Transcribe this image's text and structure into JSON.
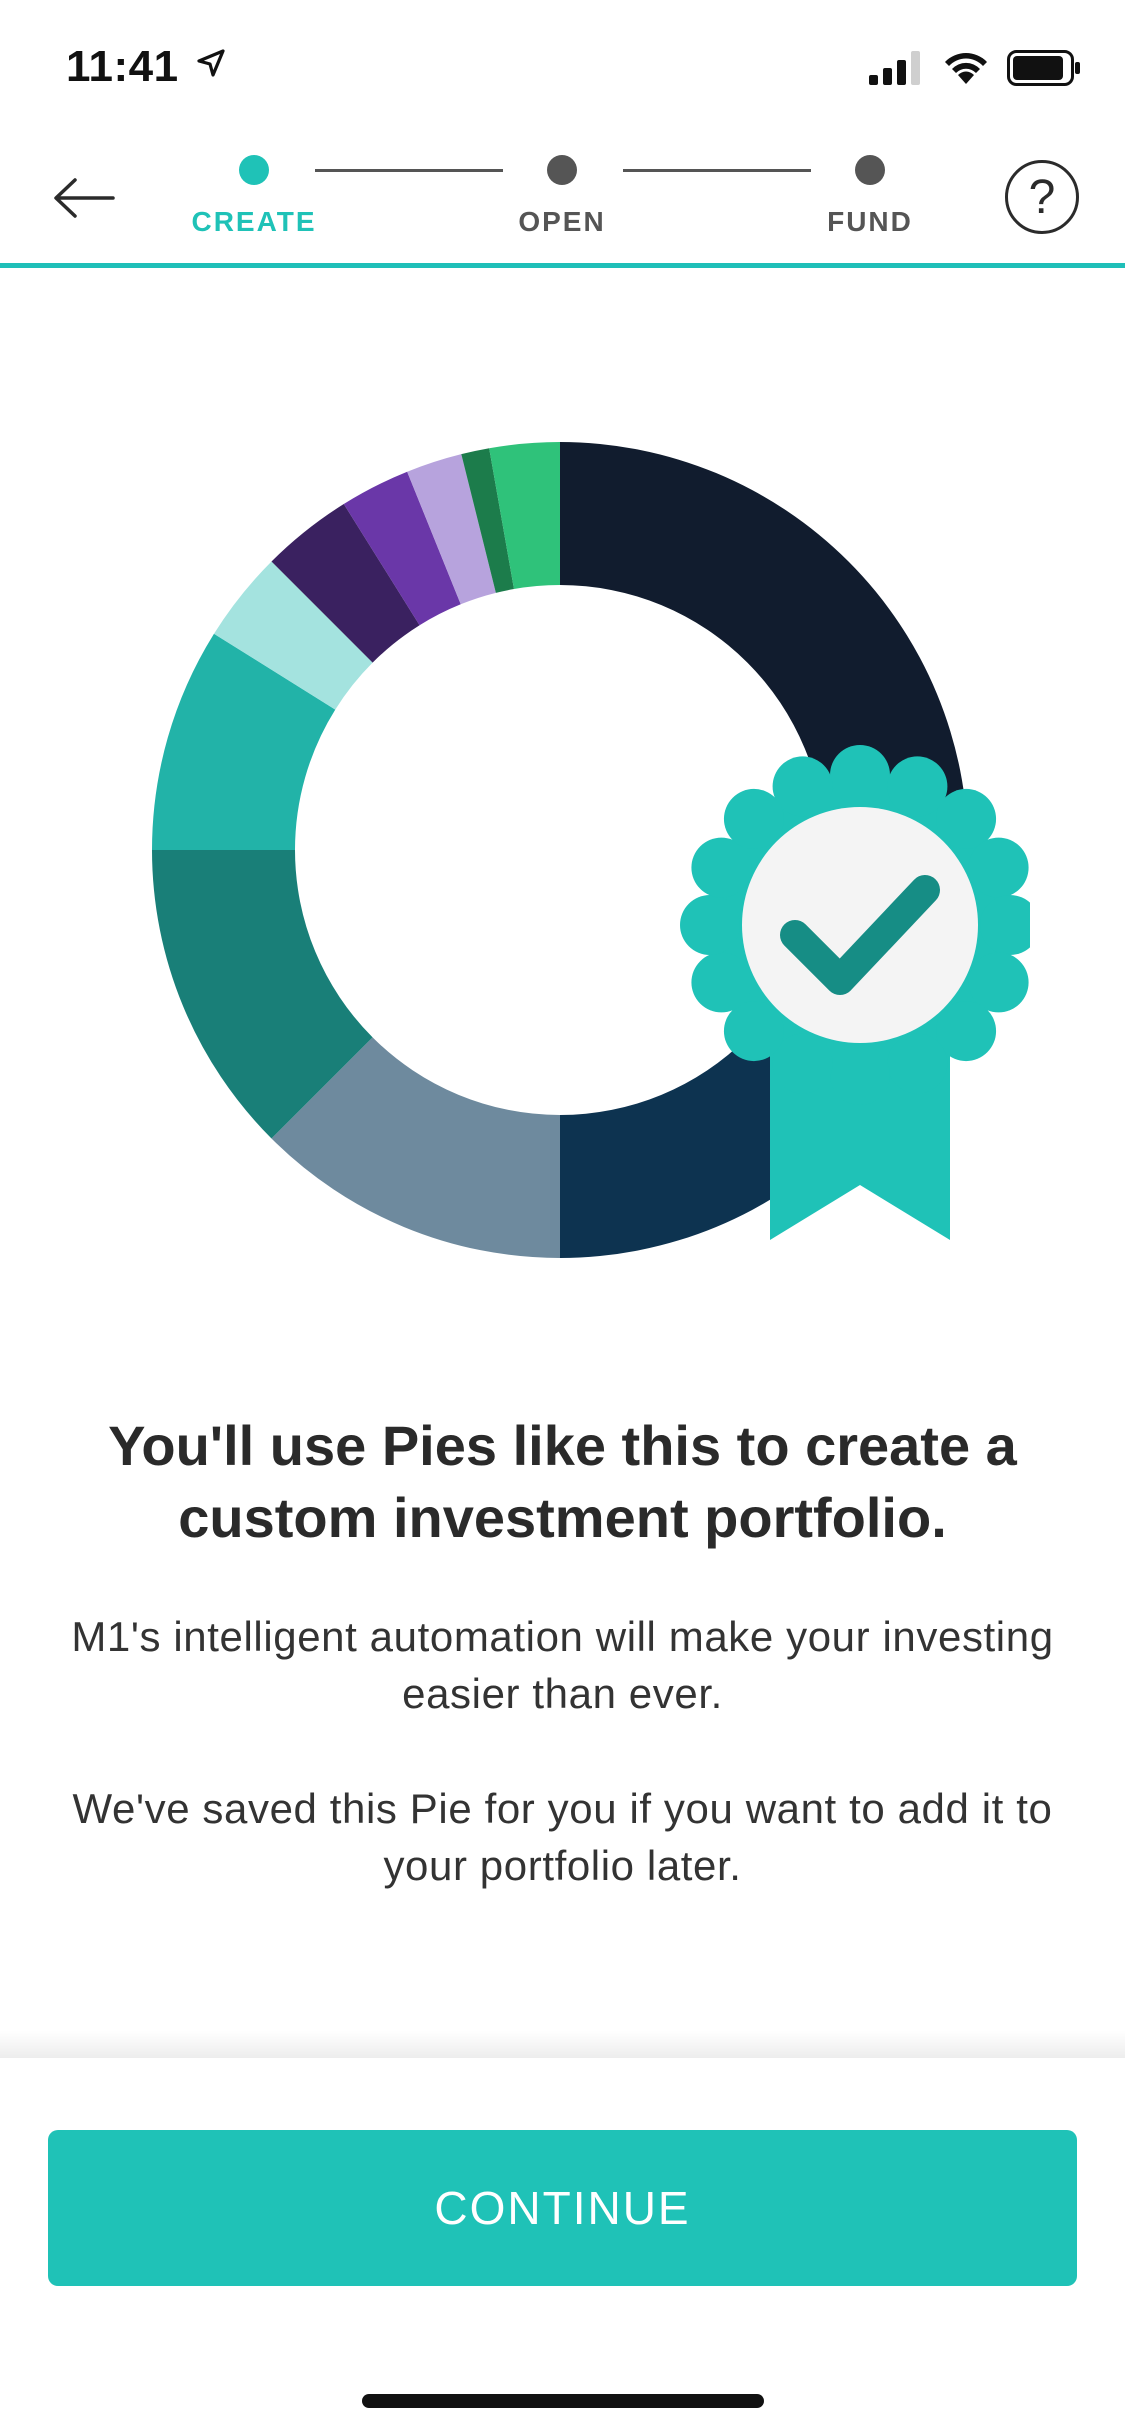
{
  "status_bar": {
    "time": "11:41"
  },
  "header": {
    "steps": [
      {
        "label": "CREATE",
        "state": "active"
      },
      {
        "label": "OPEN",
        "state": "pending"
      },
      {
        "label": "FUND",
        "state": "pending"
      }
    ],
    "help_symbol": "?"
  },
  "colors": {
    "accent": "#1fc2b7",
    "pending_step": "#555555",
    "text": "#2b2b2b"
  },
  "illustration": {
    "segment_colors": [
      "#111c2e",
      "#0d3350",
      "#6e8a9e",
      "#197f78",
      "#22b3a8",
      "#a4e3df",
      "#3a2160",
      "#6a37a8",
      "#b7a3dd",
      "#1c7c4b",
      "#2fc27a"
    ],
    "badge_icon": "check-badge-icon"
  },
  "content": {
    "headline": "You'll use Pies like this to create a custom investment portfolio.",
    "paragraph_1": "M1's intelligent automation will make your investing easier than ever.",
    "paragraph_2": "We've saved this Pie for you if you want to add it to your portfolio later."
  },
  "footer": {
    "continue_label": "CONTINUE"
  }
}
